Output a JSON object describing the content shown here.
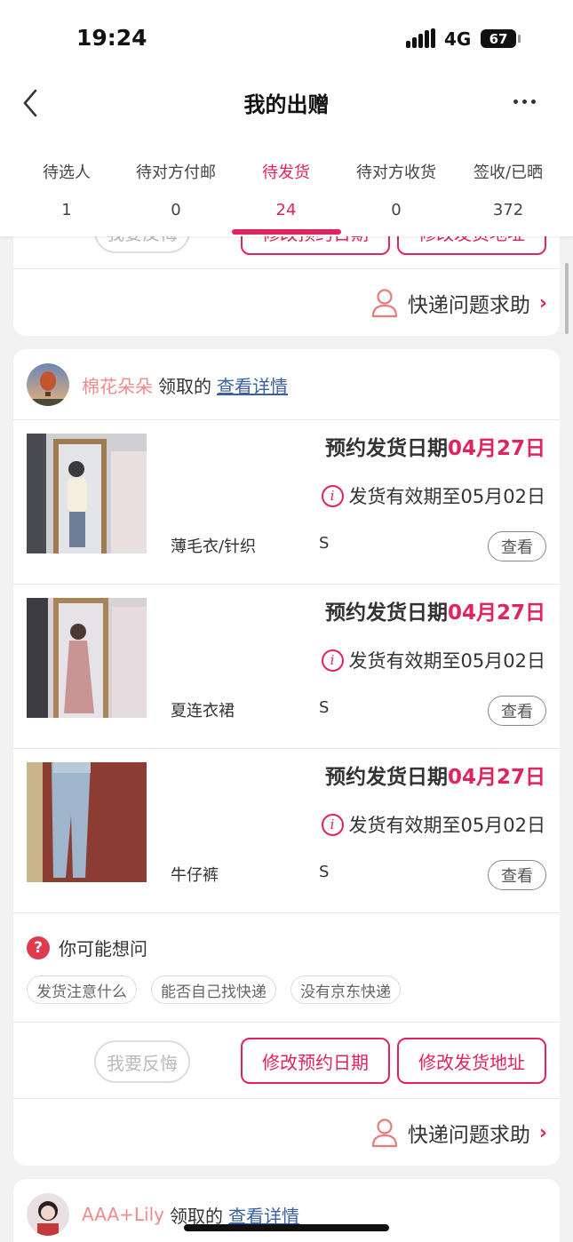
{
  "status_bar": {
    "time": "19:24",
    "network": "4G",
    "battery": "67"
  },
  "nav": {
    "title": "我的出赠"
  },
  "tabs": [
    {
      "label": "待选人",
      "count": "1"
    },
    {
      "label": "待对方付邮",
      "count": "0"
    },
    {
      "label": "待发货",
      "count": "24",
      "active": true
    },
    {
      "label": "待对方收货",
      "count": "0"
    },
    {
      "label": "签收/已晒",
      "count": "372"
    }
  ],
  "card_top": {
    "regret_label": "我要反悔",
    "change_date_label": "修改预约日期",
    "change_address_label": "修改发货地址",
    "help_label": "快递问题求助"
  },
  "card_main": {
    "user_name": "棉花朵朵",
    "claimed_text": "领取的",
    "details_link": "查看详情",
    "items": [
      {
        "name": "薄毛衣/针织",
        "size": "S",
        "date_prefix": "预约发货日期",
        "date": "04月27日",
        "expire": "发货有效期至05月02日",
        "view_label": "查看"
      },
      {
        "name": "夏连衣裙",
        "size": "S",
        "date_prefix": "预约发货日期",
        "date": "04月27日",
        "expire": "发货有效期至05月02日",
        "view_label": "查看"
      },
      {
        "name": "牛仔裤",
        "size": "S",
        "date_prefix": "预约发货日期",
        "date": "04月27日",
        "expire": "发货有效期至05月02日",
        "view_label": "查看"
      }
    ],
    "faq_title": "你可能想问",
    "faq_chips": [
      "发货注意什么",
      "能否自己找快递",
      "没有京东快递"
    ],
    "regret_label": "我要反悔",
    "change_date_label": "修改预约日期",
    "change_address_label": "修改发货地址",
    "help_label": "快递问题求助"
  },
  "card_next": {
    "user_name": "AAA+Lily",
    "claimed_text": "领取的",
    "details_link": "查看详情"
  },
  "colors": {
    "accent": "#e0245e",
    "link": "#3b5fa5",
    "username": "#f08a8a"
  }
}
